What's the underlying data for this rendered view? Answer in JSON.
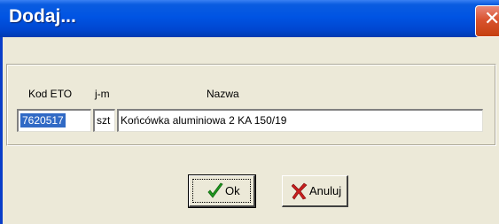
{
  "window": {
    "title": "Dodaj..."
  },
  "form": {
    "kod_label": "Kod ETO",
    "jm_label": "j-m",
    "nazwa_label": "Nazwa",
    "kod_value": "7620517",
    "jm_value": "szt",
    "nazwa_value": "Końcówka aluminiowa 2 KA 150/19"
  },
  "buttons": {
    "ok": "Ok",
    "cancel": "Anuluj"
  },
  "colors": {
    "title_bar": "#0054e3",
    "selection": "#316ac5",
    "ok_check": "#1f9a1f",
    "cancel_x": "#c81e1e"
  },
  "icons": {
    "close": "close-icon",
    "ok": "checkmark-icon",
    "cancel": "x-icon"
  }
}
